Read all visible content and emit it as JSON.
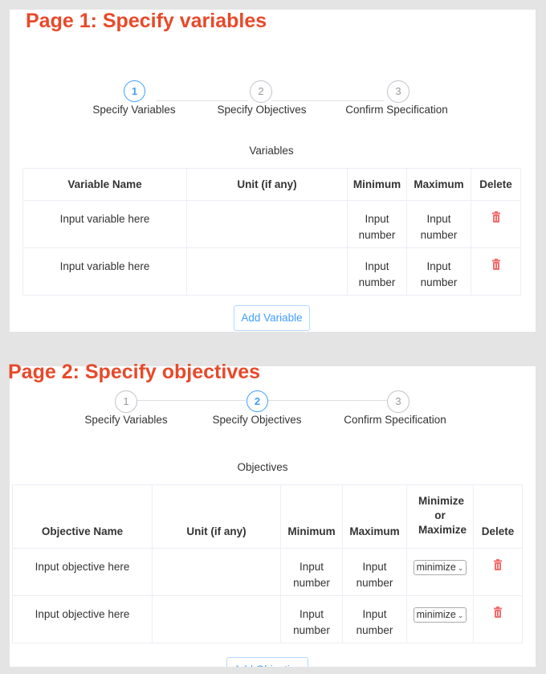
{
  "page1": {
    "title": "Page 1: Specify variables",
    "steps": [
      {
        "number": "1",
        "label": "Specify Variables",
        "active": true
      },
      {
        "number": "2",
        "label": "Specify Objectives",
        "active": false
      },
      {
        "number": "3",
        "label": "Confirm Specification",
        "active": false
      }
    ],
    "section_title": "Variables",
    "table": {
      "headers": [
        "Variable Name",
        "Unit (if any)",
        "Minimum",
        "Maximum",
        "Delete"
      ],
      "rows": [
        {
          "name": "Input variable here",
          "unit": "",
          "min": "Input number",
          "max": "Input number"
        },
        {
          "name": "Input variable here",
          "unit": "",
          "min": "Input number",
          "max": "Input number"
        }
      ]
    },
    "add_button": "Add Variable"
  },
  "page2": {
    "title": "Page 2: Specify objectives",
    "steps": [
      {
        "number": "1",
        "label": "Specify Variables",
        "active": false
      },
      {
        "number": "2",
        "label": "Specify Objectives",
        "active": true
      },
      {
        "number": "3",
        "label": "Confirm Specification",
        "active": false
      }
    ],
    "section_title": "Objectives",
    "table": {
      "headers": [
        "Objective Name",
        "Unit (if any)",
        "Minimum",
        "Maximum",
        "Minimize or Maximize",
        "Delete"
      ],
      "rows": [
        {
          "name": "Input objective here",
          "unit": "",
          "min": "Input number",
          "max": "Input number",
          "mode": "minimize"
        },
        {
          "name": "Input objective here",
          "unit": "",
          "min": "Input number",
          "max": "Input number",
          "mode": "minimize"
        }
      ]
    },
    "add_button": "Add Objective"
  },
  "colors": {
    "accent": "#409eff",
    "title": "#e8492a",
    "delete": "#f56c6c"
  },
  "icons": {
    "delete": "trash-icon",
    "dropdown": "chevron-down-icon"
  }
}
